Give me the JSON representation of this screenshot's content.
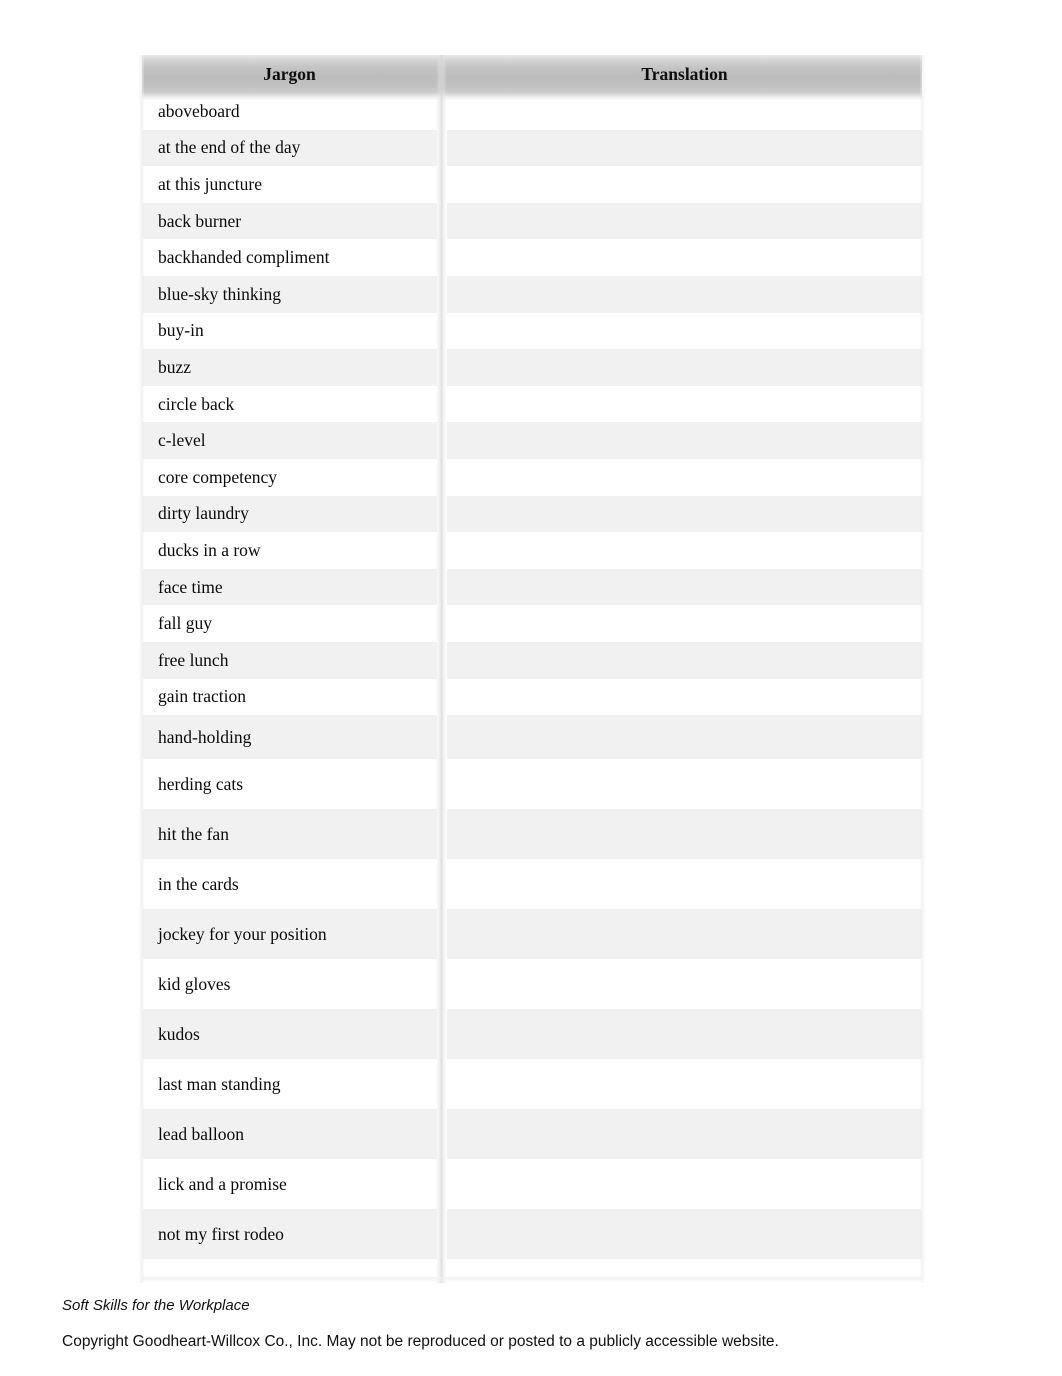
{
  "document": {
    "columns": [
      "Jargon",
      "Translation"
    ],
    "rows": [
      {
        "jargon": "aboveboard",
        "translation": "",
        "size": "tight"
      },
      {
        "jargon": "at the end of the day",
        "translation": "",
        "size": "tight"
      },
      {
        "jargon": "at this juncture",
        "translation": "",
        "size": "tight"
      },
      {
        "jargon": "back burner",
        "translation": "",
        "size": "tight"
      },
      {
        "jargon": "backhanded compliment",
        "translation": "",
        "size": "tight"
      },
      {
        "jargon": "blue-sky thinking",
        "translation": "",
        "size": "tight"
      },
      {
        "jargon": "buy-in",
        "translation": "",
        "size": "tight"
      },
      {
        "jargon": "buzz",
        "translation": "",
        "size": "tight"
      },
      {
        "jargon": "circle back",
        "translation": "",
        "size": "tight"
      },
      {
        "jargon": "c-level",
        "translation": "",
        "size": "tight"
      },
      {
        "jargon": "core competency",
        "translation": "",
        "size": "tight"
      },
      {
        "jargon": "dirty laundry",
        "translation": "",
        "size": "tight"
      },
      {
        "jargon": "ducks in a row",
        "translation": "",
        "size": "tight"
      },
      {
        "jargon": "face time",
        "translation": "",
        "size": "tight"
      },
      {
        "jargon": "fall guy",
        "translation": "",
        "size": "tight"
      },
      {
        "jargon": "free lunch",
        "translation": "",
        "size": "tight"
      },
      {
        "jargon": "gain traction",
        "translation": "",
        "size": "tight"
      },
      {
        "jargon": "hand-holding",
        "translation": "",
        "size": "mid"
      },
      {
        "jargon": "herding cats",
        "translation": "",
        "size": "tall"
      },
      {
        "jargon": "hit the fan",
        "translation": "",
        "size": "tall"
      },
      {
        "jargon": "in the cards",
        "translation": "",
        "size": "tall"
      },
      {
        "jargon": "jockey for your position",
        "translation": "",
        "size": "tall"
      },
      {
        "jargon": "kid gloves",
        "translation": "",
        "size": "tall"
      },
      {
        "jargon": "kudos",
        "translation": "",
        "size": "tall"
      },
      {
        "jargon": "last man standing",
        "translation": "",
        "size": "tall"
      },
      {
        "jargon": "lead balloon",
        "translation": "",
        "size": "tall"
      },
      {
        "jargon": "lick and a promise",
        "translation": "",
        "size": "tall"
      },
      {
        "jargon": "not my first rodeo",
        "translation": "",
        "size": "tall"
      }
    ]
  },
  "footer": {
    "title": "Soft Skills for the Workplace",
    "copyright": "Copyright Goodheart-Willcox Co., Inc. May not be reproduced or posted to a publicly accessible website."
  },
  "colors": {
    "page_background": "#ffffff",
    "header_gradient_top": "#e9e9e9",
    "header_gradient_mid": "#bcbcbc",
    "header_gradient_bottom": "#cfcfcf",
    "row_stripe": "#f1f1f1",
    "row_plain": "#ffffff",
    "text": "#0a0a0a"
  }
}
